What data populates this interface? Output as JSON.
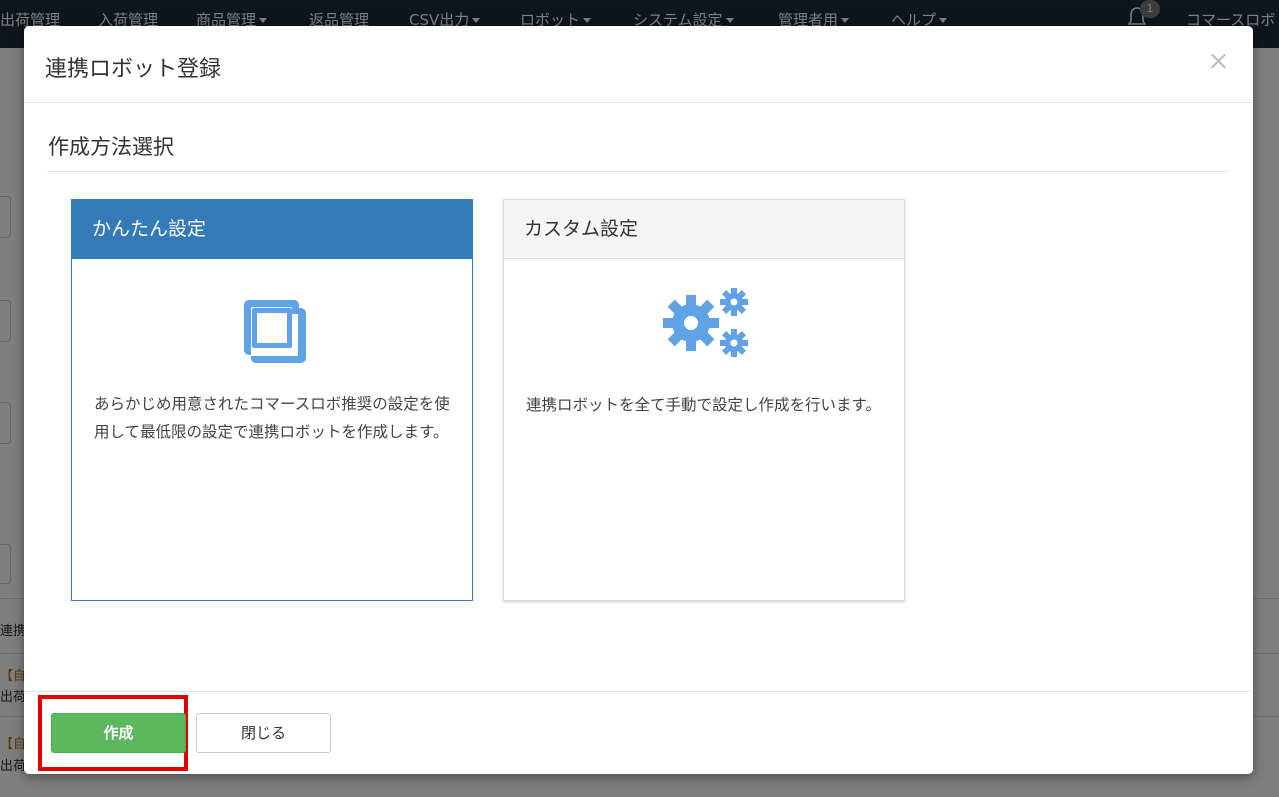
{
  "navbar": {
    "items": [
      {
        "label": "出荷管理",
        "dropdown": false
      },
      {
        "label": "入荷管理",
        "dropdown": false
      },
      {
        "label": "商品管理",
        "dropdown": true
      },
      {
        "label": "返品管理",
        "dropdown": false
      },
      {
        "label": "CSV出力",
        "dropdown": true
      },
      {
        "label": "ロボット",
        "dropdown": true
      },
      {
        "label": "システム設定",
        "dropdown": true
      },
      {
        "label": "管理者用",
        "dropdown": true
      },
      {
        "label": "ヘルプ",
        "dropdown": true
      }
    ],
    "notification_count": "1",
    "user_label": "コマースロボ"
  },
  "background": {
    "list_header": "連携",
    "row1_line1": "【自",
    "row1_line2": "出荷",
    "row2_line1": "【自",
    "row2_line2": "出荷"
  },
  "modal": {
    "title": "連携ロボット登録",
    "section_title": "作成方法選択",
    "cards": [
      {
        "title": "かんたん設定",
        "icon": "copy-icon",
        "description": "あらかじめ用意されたコマースロボ推奨の設定を使用して最低限の設定で連携ロボットを作成します。",
        "selected": true
      },
      {
        "title": "カスタム設定",
        "icon": "cogs-icon",
        "description": "連携ロボットを全て手動で設定し作成を行います。",
        "selected": false
      }
    ],
    "footer": {
      "create_label": "作成",
      "close_label": "閉じる"
    }
  },
  "colors": {
    "primary": "#337ab7",
    "icon_blue": "#5fa2e6",
    "success": "#5cb85c",
    "highlight": "#e00000",
    "navbar": "#1a2b3d"
  }
}
